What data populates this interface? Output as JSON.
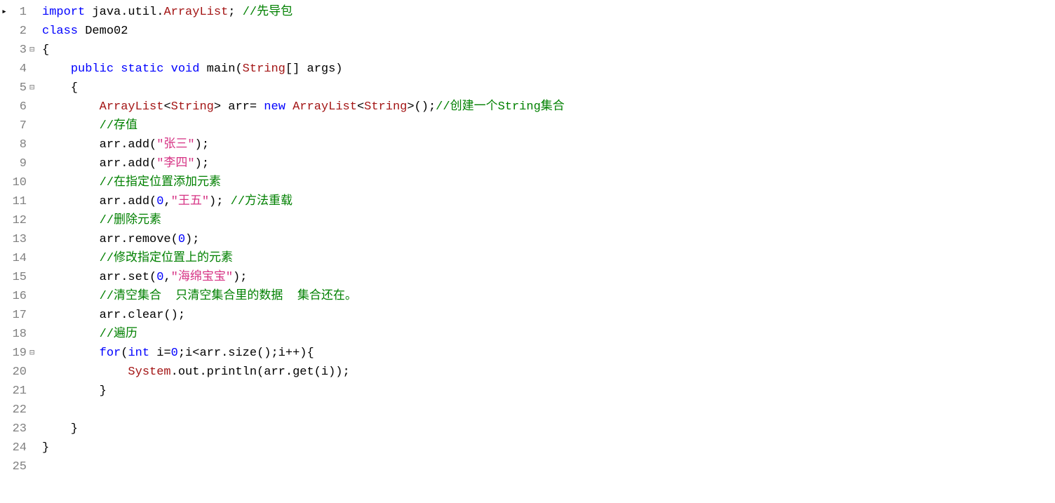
{
  "lines": [
    {
      "num": "1",
      "marker": "▸",
      "fold": "",
      "tokens": [
        {
          "t": "import ",
          "c": "kw"
        },
        {
          "t": "java.util.",
          "c": ""
        },
        {
          "t": "ArrayList",
          "c": "cls"
        },
        {
          "t": "; ",
          "c": ""
        },
        {
          "t": "//先导包",
          "c": "cmt"
        }
      ]
    },
    {
      "num": "2",
      "marker": "",
      "fold": "",
      "tokens": [
        {
          "t": "class ",
          "c": "kw"
        },
        {
          "t": "Demo02",
          "c": ""
        }
      ]
    },
    {
      "num": "3",
      "marker": "",
      "fold": "⊟",
      "tokens": [
        {
          "t": "{",
          "c": ""
        }
      ]
    },
    {
      "num": "4",
      "marker": "",
      "fold": "",
      "tokens": [
        {
          "t": "    ",
          "c": ""
        },
        {
          "t": "public static void ",
          "c": "kw"
        },
        {
          "t": "main(",
          "c": ""
        },
        {
          "t": "String",
          "c": "cls"
        },
        {
          "t": "[] args)",
          "c": ""
        }
      ]
    },
    {
      "num": "5",
      "marker": "",
      "fold": "⊟",
      "tokens": [
        {
          "t": "    {",
          "c": ""
        }
      ]
    },
    {
      "num": "6",
      "marker": "",
      "fold": "",
      "tokens": [
        {
          "t": "        ",
          "c": ""
        },
        {
          "t": "ArrayList",
          "c": "cls"
        },
        {
          "t": "<",
          "c": ""
        },
        {
          "t": "String",
          "c": "cls"
        },
        {
          "t": "> arr= ",
          "c": ""
        },
        {
          "t": "new ",
          "c": "kw"
        },
        {
          "t": "ArrayList",
          "c": "cls"
        },
        {
          "t": "<",
          "c": ""
        },
        {
          "t": "String",
          "c": "cls"
        },
        {
          "t": ">();",
          "c": ""
        },
        {
          "t": "//创建一个String集合",
          "c": "cmt"
        }
      ]
    },
    {
      "num": "7",
      "marker": "",
      "fold": "",
      "tokens": [
        {
          "t": "        ",
          "c": ""
        },
        {
          "t": "//存值",
          "c": "cmt"
        }
      ]
    },
    {
      "num": "8",
      "marker": "",
      "fold": "",
      "tokens": [
        {
          "t": "        arr.add(",
          "c": ""
        },
        {
          "t": "\"张三\"",
          "c": "strpink"
        },
        {
          "t": ");",
          "c": ""
        }
      ]
    },
    {
      "num": "9",
      "marker": "",
      "fold": "",
      "tokens": [
        {
          "t": "        arr.add(",
          "c": ""
        },
        {
          "t": "\"李四\"",
          "c": "strpink"
        },
        {
          "t": ");",
          "c": ""
        }
      ]
    },
    {
      "num": "10",
      "marker": "",
      "fold": "",
      "tokens": [
        {
          "t": "        ",
          "c": ""
        },
        {
          "t": "//在指定位置添加元素",
          "c": "cmt"
        }
      ]
    },
    {
      "num": "11",
      "marker": "",
      "fold": "",
      "tokens": [
        {
          "t": "        arr.add(",
          "c": ""
        },
        {
          "t": "0",
          "c": "num"
        },
        {
          "t": ",",
          "c": ""
        },
        {
          "t": "\"王五\"",
          "c": "strpink"
        },
        {
          "t": "); ",
          "c": ""
        },
        {
          "t": "//方法重载",
          "c": "cmt"
        }
      ]
    },
    {
      "num": "12",
      "marker": "",
      "fold": "",
      "tokens": [
        {
          "t": "        ",
          "c": ""
        },
        {
          "t": "//删除元素",
          "c": "cmt"
        }
      ]
    },
    {
      "num": "13",
      "marker": "",
      "fold": "",
      "tokens": [
        {
          "t": "        arr.remove(",
          "c": ""
        },
        {
          "t": "0",
          "c": "num"
        },
        {
          "t": ");",
          "c": ""
        }
      ]
    },
    {
      "num": "14",
      "marker": "",
      "fold": "",
      "tokens": [
        {
          "t": "        ",
          "c": ""
        },
        {
          "t": "//修改指定位置上的元素",
          "c": "cmt"
        }
      ]
    },
    {
      "num": "15",
      "marker": "",
      "fold": "",
      "tokens": [
        {
          "t": "        arr.set(",
          "c": ""
        },
        {
          "t": "0",
          "c": "num"
        },
        {
          "t": ",",
          "c": ""
        },
        {
          "t": "\"海绵宝宝\"",
          "c": "strpink"
        },
        {
          "t": ");",
          "c": ""
        }
      ]
    },
    {
      "num": "16",
      "marker": "",
      "fold": "",
      "tokens": [
        {
          "t": "        ",
          "c": ""
        },
        {
          "t": "//清空集合  只清空集合里的数据  集合还在。",
          "c": "cmt"
        }
      ]
    },
    {
      "num": "17",
      "marker": "",
      "fold": "",
      "tokens": [
        {
          "t": "        arr.clear();",
          "c": ""
        }
      ]
    },
    {
      "num": "18",
      "marker": "",
      "fold": "",
      "tokens": [
        {
          "t": "        ",
          "c": ""
        },
        {
          "t": "//遍历",
          "c": "cmt"
        }
      ]
    },
    {
      "num": "19",
      "marker": "",
      "fold": "⊟",
      "tokens": [
        {
          "t": "        ",
          "c": ""
        },
        {
          "t": "for",
          "c": "kw"
        },
        {
          "t": "(",
          "c": ""
        },
        {
          "t": "int ",
          "c": "kw"
        },
        {
          "t": "i=",
          "c": ""
        },
        {
          "t": "0",
          "c": "num"
        },
        {
          "t": ";i<arr.size();i++){",
          "c": ""
        }
      ]
    },
    {
      "num": "20",
      "marker": "",
      "fold": "",
      "tokens": [
        {
          "t": "            ",
          "c": ""
        },
        {
          "t": "System",
          "c": "cls"
        },
        {
          "t": ".out.println(arr.get(i));",
          "c": ""
        }
      ]
    },
    {
      "num": "21",
      "marker": "",
      "fold": "",
      "tokens": [
        {
          "t": "        }",
          "c": ""
        }
      ]
    },
    {
      "num": "22",
      "marker": "",
      "fold": "",
      "tokens": [
        {
          "t": "",
          "c": ""
        }
      ]
    },
    {
      "num": "23",
      "marker": "",
      "fold": "",
      "tokens": [
        {
          "t": "    }",
          "c": ""
        }
      ]
    },
    {
      "num": "24",
      "marker": "",
      "fold": "",
      "tokens": [
        {
          "t": "}",
          "c": ""
        }
      ]
    },
    {
      "num": "25",
      "marker": "",
      "fold": "",
      "tokens": [
        {
          "t": "",
          "c": ""
        }
      ]
    }
  ]
}
